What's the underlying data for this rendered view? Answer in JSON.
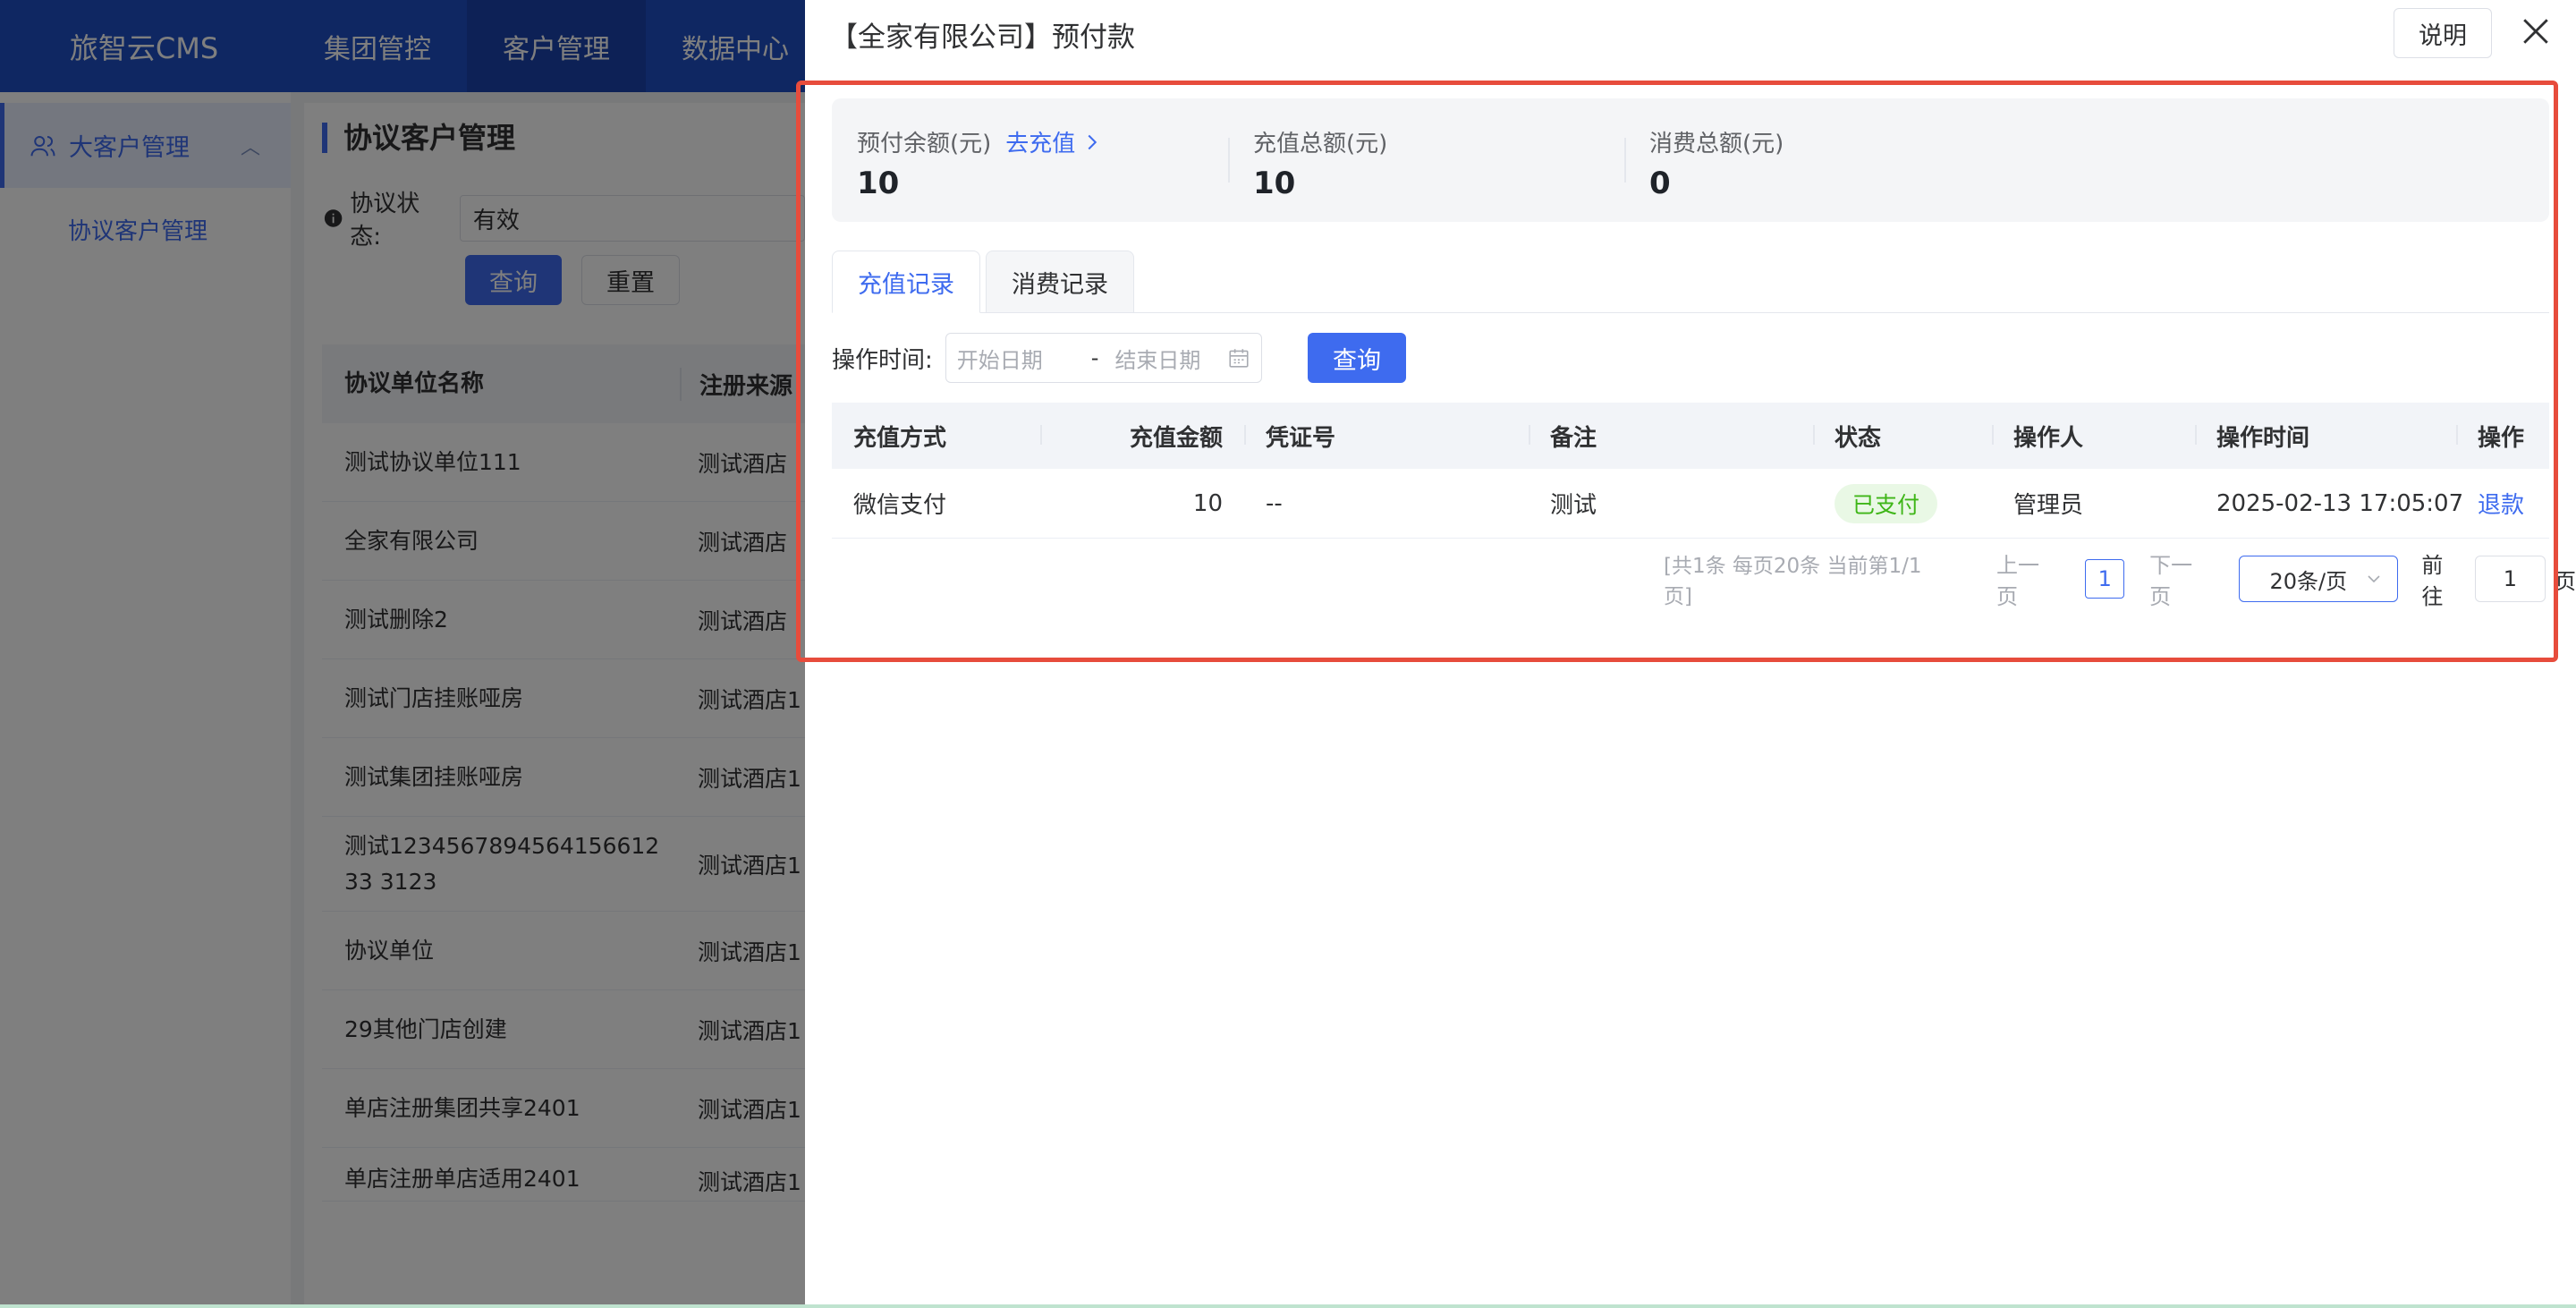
{
  "app": {
    "logo": "旅智云CMS",
    "nav": [
      "集团管控",
      "客户管理",
      "数据中心"
    ]
  },
  "sidebar": {
    "group_label": "大客户管理",
    "sub_label": "协议客户管理"
  },
  "main": {
    "title": "协议客户管理",
    "filter_label": "协议状态:",
    "filter_value": "有效",
    "query_label": "查询",
    "reset_label": "重置",
    "columns": [
      "协议单位名称",
      "注册来源"
    ],
    "rows": [
      {
        "name": "测试协议单位111",
        "source": "测试酒店"
      },
      {
        "name": "全家有限公司",
        "source": "测试酒店"
      },
      {
        "name": "测试删除2",
        "source": "测试酒店"
      },
      {
        "name": "测试门店挂账哑房",
        "source": "测试酒店1"
      },
      {
        "name": "测试集团挂账哑房",
        "source": "测试酒店1"
      },
      {
        "name": "测试123456789456415661233 3123",
        "source": "测试酒店1"
      },
      {
        "name": "协议单位",
        "source": "测试酒店1"
      },
      {
        "name": "29其他门店创建",
        "source": "测试酒店1"
      },
      {
        "name": "单店注册集团共享2401",
        "source": "测试酒店1"
      },
      {
        "name": "单店注册单店适用2401",
        "source": "测试酒店1"
      }
    ]
  },
  "drawer": {
    "title": "【全家有限公司】预付款",
    "explain_label": "说明",
    "stats": {
      "balance_label": "预付余额(元)",
      "recharge_link": "去充值",
      "balance_value": "10",
      "recharge_total_label": "充值总额(元)",
      "recharge_total_value": "10",
      "consume_total_label": "消费总额(元)",
      "consume_total_value": "0"
    },
    "tabs": [
      "充值记录",
      "消费记录"
    ],
    "query": {
      "label": "操作时间:",
      "start_placeholder": "开始日期",
      "separator": "-",
      "end_placeholder": "结束日期",
      "button": "查询"
    },
    "table": {
      "columns": [
        "充值方式",
        "充值金额",
        "凭证号",
        "备注",
        "状态",
        "操作人",
        "操作时间",
        "操作"
      ],
      "row": {
        "method": "微信支付",
        "amount": "10",
        "voucher": "--",
        "remark": "测试",
        "status": "已支付",
        "operator": "管理员",
        "time": "2025-02-13 17:05:07",
        "action": "退款"
      }
    },
    "pager": {
      "summary": "[共1条 每页20条 当前第1/1页]",
      "prev": "上一页",
      "current": "1",
      "next": "下一页",
      "page_size": "20条/页",
      "goto_label": "前往",
      "goto_value": "1",
      "page_unit": "页"
    }
  },
  "colors": {
    "primary": "#3e6bef",
    "topbar": "#1f4fc5",
    "success": "#3fb618",
    "highlight": "#e74c3c"
  }
}
